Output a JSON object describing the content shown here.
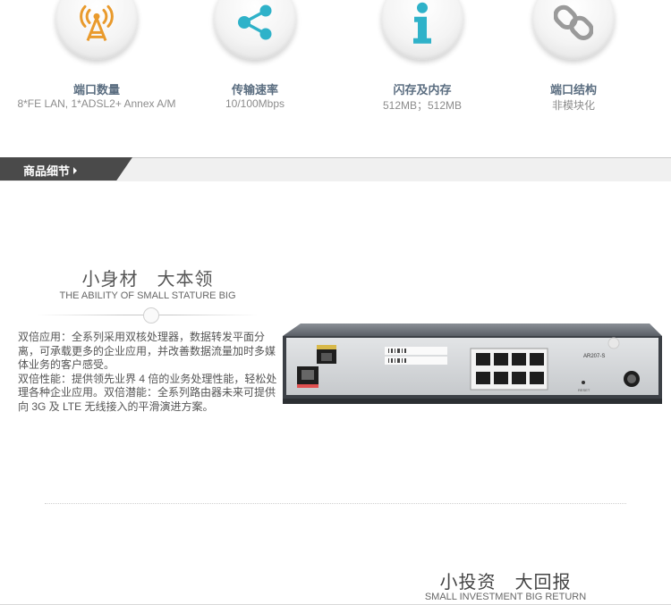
{
  "features": [
    {
      "icon": "antenna-tower-icon",
      "title": "端口数量",
      "sub": "8*FE LAN, 1*ADSL2+ Annex A/M"
    },
    {
      "icon": "share-icon",
      "title": "传输速率",
      "sub": "10/100Mbps"
    },
    {
      "icon": "info-icon",
      "title": "闪存及内存",
      "sub": "512MB；512MB"
    },
    {
      "icon": "chain-link-icon",
      "title": "端口结构",
      "sub": "非模块化"
    }
  ],
  "section_header": {
    "label": "商品细节"
  },
  "section1": {
    "title": "小身材　大本领",
    "subtitle": "THE ABILITY OF SMALL STATURE BIG",
    "paragraphs": [
      "双倍应用：全系列采用双核处理器，数据转发平面分离，可承载更多的企业应用，并改善数据流量加时多媒体业务的客户感受。",
      "双倍性能：提供领先业界 4 倍的业务处理性能，轻松处理各种企业应用。双倍潜能：全系列路由器未来可提供向 3G 及 LTE 无线接入的平滑演进方案。"
    ],
    "router_model": "AR207-S",
    "router_reset": "RESET"
  },
  "section2": {
    "title": "小投资　大回报",
    "subtitle": "SMALL INVESTMENT BIG RETURN"
  },
  "colors": {
    "accent": "#5a6d80",
    "icon_orange": "#e99a2c",
    "icon_teal": "#2fb2c9",
    "header_dark": "#4a4a4a"
  }
}
